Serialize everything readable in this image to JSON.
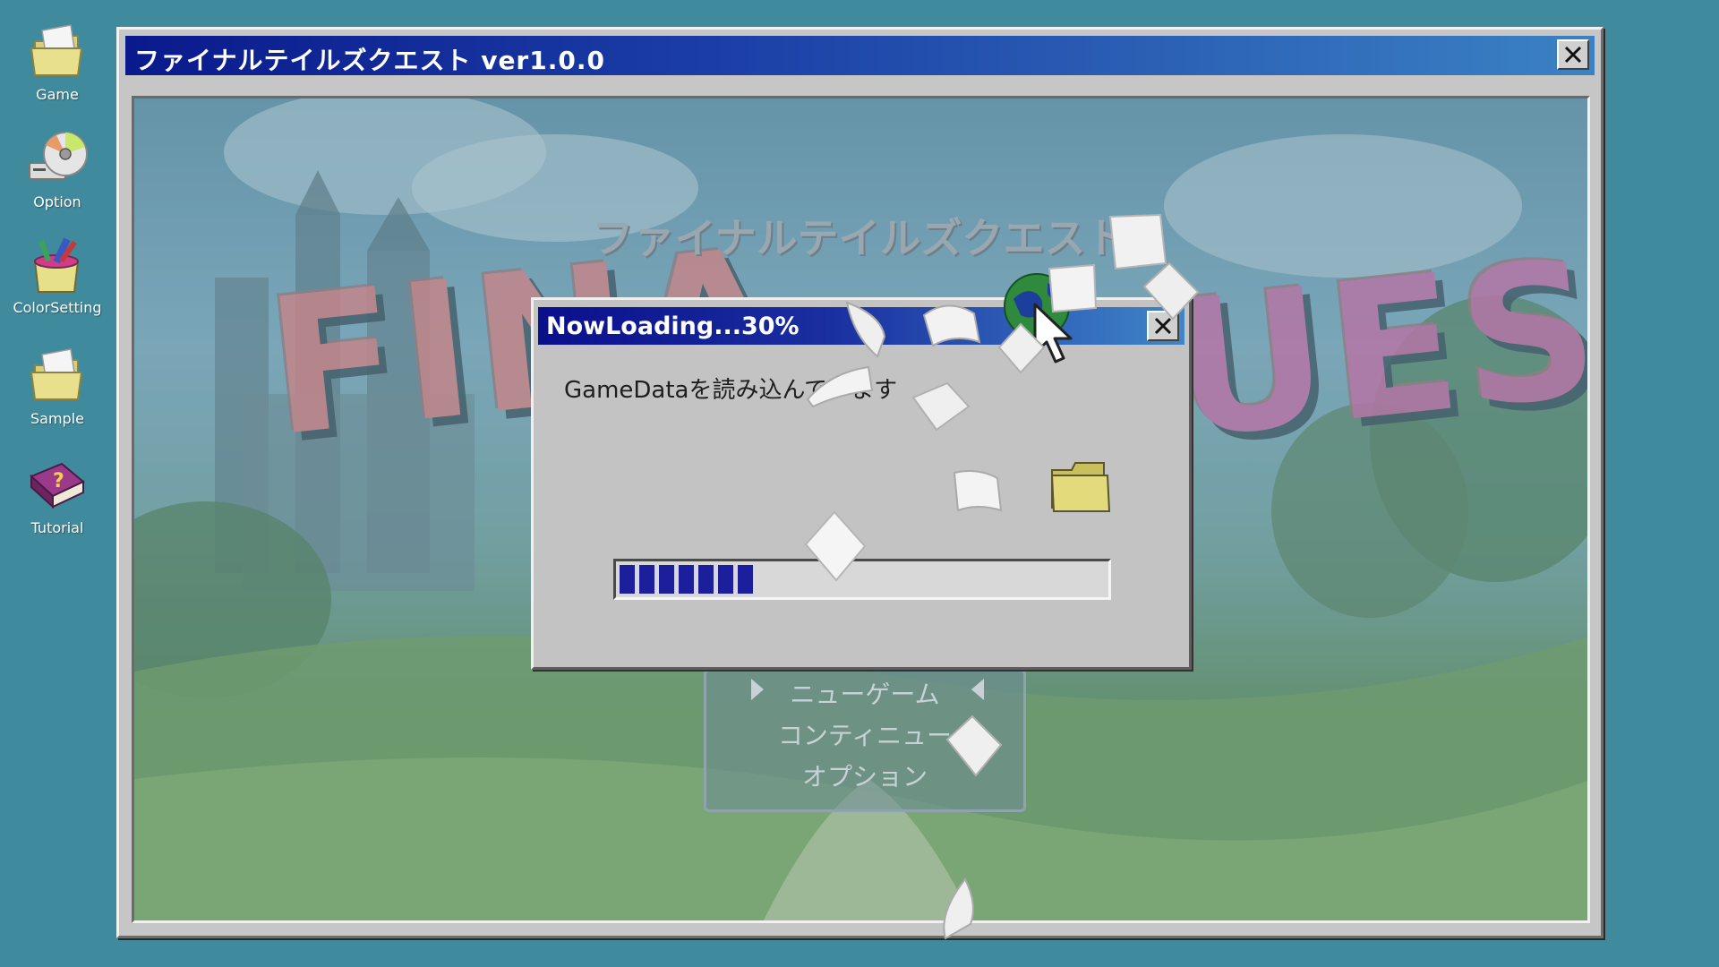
{
  "desktop": {
    "icons": [
      {
        "label": "Game",
        "icon": "folder-icon"
      },
      {
        "label": "Option",
        "icon": "cd-drive-icon"
      },
      {
        "label": "ColorSetting",
        "icon": "paint-bucket-icon"
      },
      {
        "label": "Sample",
        "icon": "folder-icon"
      },
      {
        "label": "Tutorial",
        "icon": "help-book-icon"
      }
    ]
  },
  "main_window": {
    "title": "ファイナルテイルズクエスト ver1.0.0",
    "close_icon": "close-icon"
  },
  "game": {
    "subtitle": "ファイナルテイルズクエスト",
    "logo_left": "FINA",
    "logo_right": "UEST",
    "menu": {
      "items": [
        "ニューゲーム",
        "コンティニュー",
        "オプション"
      ],
      "selected_index": 0
    }
  },
  "loading_dialog": {
    "title": "NowLoading...30%",
    "message": "GameDataを読み込んでいます",
    "progress_percent": 30,
    "progress_segments_filled": 7,
    "close_icon": "close-icon",
    "animation_icons": [
      "globe-icon",
      "folder-icon",
      "paper-sheet-icon"
    ]
  },
  "colors": {
    "desktop_bg": "#3f8a9c",
    "titlebar_dark": "#0a1a8c",
    "titlebar_light": "#3b82c4",
    "progress_fill": "#1c1f9c",
    "window_gray": "#c6c6c6"
  }
}
